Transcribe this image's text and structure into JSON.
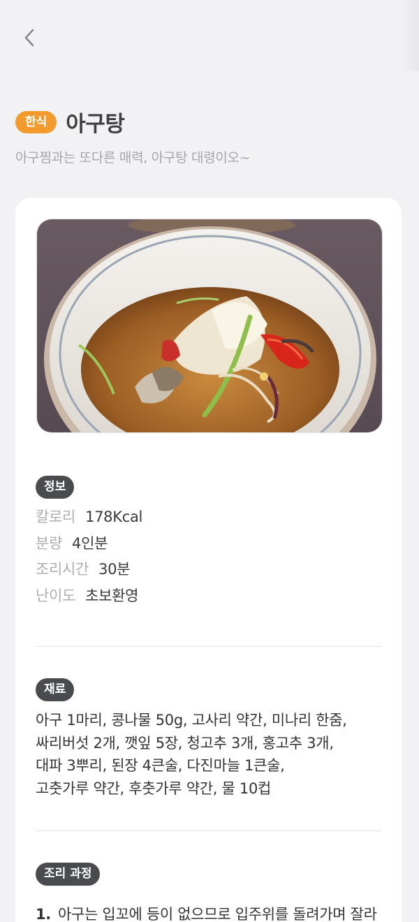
{
  "header": {
    "back_icon": "chevron-left-icon"
  },
  "recipe": {
    "category": "한식",
    "title": "아구탕",
    "subtitle": "아구찜과는 또다른 매력, 아구탕 대령이오~",
    "photo_desc": "bowl of monkfish soup"
  },
  "info": {
    "label": "정보",
    "rows": [
      {
        "key": "칼로리",
        "value": "178Kcal"
      },
      {
        "key": "분량",
        "value": "4인분"
      },
      {
        "key": "조리시간",
        "value": "30분"
      },
      {
        "key": "난이도",
        "value": "초보환영"
      }
    ]
  },
  "ingredients": {
    "label": "재료",
    "lines": [
      "아구 1마리, 콩나물 50g, 고사리 약간, 미나리 한줌,",
      "싸리버섯 2개, 깻잎 5장, 청고추 3개, 홍고추 3개,",
      "대파 3뿌리, 된장 4큰술, 다진마늘 1큰술,",
      "고춧가루 약간, 후춧가루 약간, 물 10컵"
    ]
  },
  "steps": {
    "label": "조리 과정",
    "items": [
      {
        "num": "1.",
        "text": "아구는 입꼬에 등이 없으므로 입주위를 돌려가며 잘라"
      }
    ]
  }
}
